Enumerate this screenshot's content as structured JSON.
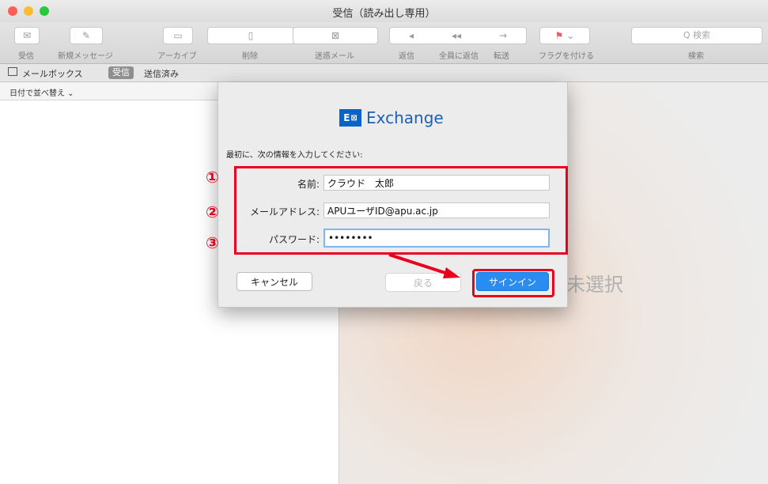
{
  "window": {
    "title": "受信（読み出し専用）"
  },
  "toolbar": {
    "inbox": "受信",
    "new_message": "新規メッセージ",
    "archive": "アーカイブ",
    "delete": "削除",
    "junk": "迷惑メール",
    "reply": "返信",
    "reply_all": "全員に返信",
    "forward": "転送",
    "flag": "フラグを付ける",
    "search_placeholder": "Q 検索",
    "search_label": "検索"
  },
  "favorites": {
    "mailboxes": "メールボックス",
    "inbox": "受信",
    "sent": "送信済み"
  },
  "list": {
    "sort": "日付で並べ替え ⌄"
  },
  "viewer": {
    "no_selection": "ジ未選択"
  },
  "dialog": {
    "brand": "Exchange",
    "logo_letter": "E",
    "logo_mark": "⊠",
    "prompt": "最初に、次の情報を入力してください:",
    "name_label": "名前:",
    "name_value": "クラウド　太郎",
    "email_label": "メールアドレス:",
    "email_value": "APUユーザID@apu.ac.jp",
    "password_label": "パスワード:",
    "password_value": "••••••••",
    "cancel": "キャンセル",
    "back": "戻る",
    "signin": "サインイン"
  },
  "annotations": {
    "one": "①",
    "two": "②",
    "three": "③"
  }
}
